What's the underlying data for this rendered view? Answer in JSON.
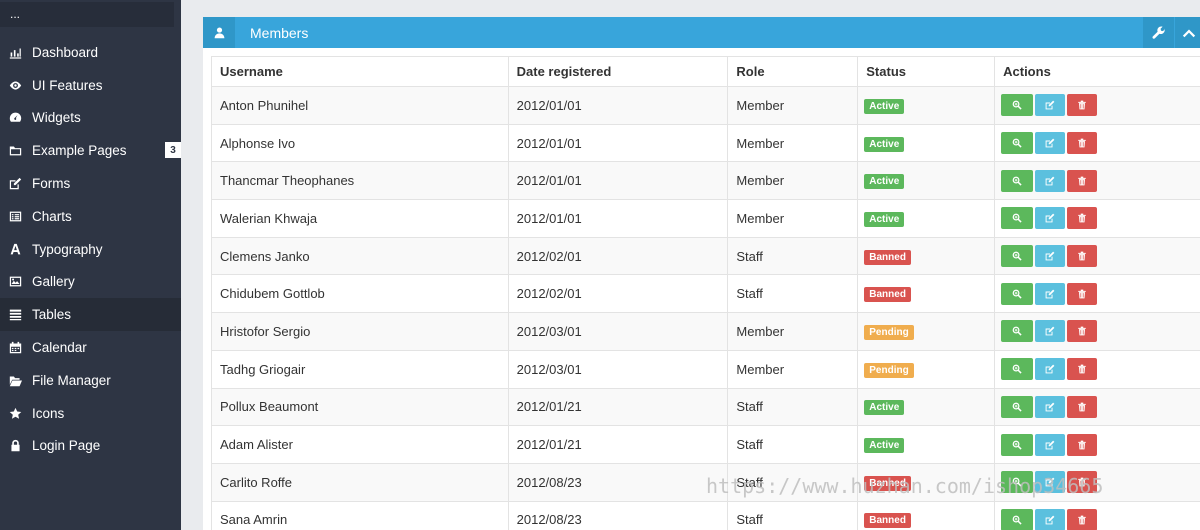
{
  "sidebar": {
    "top_text": "...",
    "items": [
      {
        "label": "Dashboard",
        "icon": "bar-chart-icon"
      },
      {
        "label": "UI Features",
        "icon": "eye-icon"
      },
      {
        "label": "Widgets",
        "icon": "dashboard-icon"
      },
      {
        "label": "Example Pages",
        "icon": "folder-icon",
        "badge": "3"
      },
      {
        "label": "Forms",
        "icon": "edit-icon"
      },
      {
        "label": "Charts",
        "icon": "list-alt-icon"
      },
      {
        "label": "Typography",
        "icon": "font-icon"
      },
      {
        "label": "Gallery",
        "icon": "picture-icon"
      },
      {
        "label": "Tables",
        "icon": "table-icon",
        "active": true
      },
      {
        "label": "Calendar",
        "icon": "calendar-icon"
      },
      {
        "label": "File Manager",
        "icon": "folder-open-icon"
      },
      {
        "label": "Icons",
        "icon": "star-icon"
      },
      {
        "label": "Login Page",
        "icon": "lock-icon"
      }
    ]
  },
  "panel": {
    "title": "Members",
    "icon": "user-icon",
    "tool_icons": [
      "wrench-icon",
      "chevron-up-icon"
    ]
  },
  "table": {
    "headers": [
      "Username",
      "Date registered",
      "Role",
      "Status",
      "Actions"
    ],
    "rows": [
      [
        "Anton Phunihel",
        "2012/01/01",
        "Member",
        "Active"
      ],
      [
        "Alphonse Ivo",
        "2012/01/01",
        "Member",
        "Active"
      ],
      [
        "Thancmar Theophanes",
        "2012/01/01",
        "Member",
        "Active"
      ],
      [
        "Walerian Khwaja",
        "2012/01/01",
        "Member",
        "Active"
      ],
      [
        "Clemens Janko",
        "2012/02/01",
        "Staff",
        "Banned"
      ],
      [
        "Chidubem Gottlob",
        "2012/02/01",
        "Staff",
        "Banned"
      ],
      [
        "Hristofor Sergio",
        "2012/03/01",
        "Member",
        "Pending"
      ],
      [
        "Tadhg Griogair",
        "2012/03/01",
        "Member",
        "Pending"
      ],
      [
        "Pollux Beaumont",
        "2012/01/21",
        "Staff",
        "Active"
      ],
      [
        "Adam Alister",
        "2012/01/21",
        "Staff",
        "Active"
      ],
      [
        "Carlito Roffe",
        "2012/08/23",
        "Staff",
        "Banned"
      ],
      [
        "Sana Amrin",
        "2012/08/23",
        "Staff",
        "Banned"
      ]
    ],
    "action_icons": [
      "zoom-in-icon",
      "edit-icon",
      "trash-icon"
    ]
  },
  "colors": {
    "sidebar_bg": "#2e3544",
    "header_blue": "#38a5db",
    "success": "#5cb85c",
    "info": "#5bc0de",
    "danger": "#d9534f",
    "warning": "#f0ad4e"
  },
  "watermark": "https://www.huzhan.com/ishop34665"
}
